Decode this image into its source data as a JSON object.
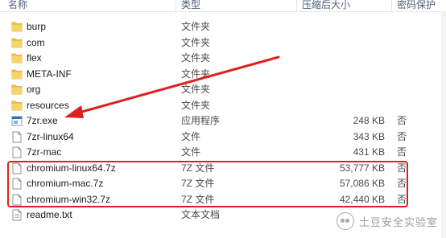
{
  "columns": {
    "name": "名称",
    "type": "类型",
    "size": "压缩后大小",
    "protected": "密码保护"
  },
  "files": [
    {
      "name": "burp",
      "type": "文件夹",
      "size": "",
      "protected": "",
      "icon": "folder-icon"
    },
    {
      "name": "com",
      "type": "文件夹",
      "size": "",
      "protected": "",
      "icon": "folder-icon"
    },
    {
      "name": "flex",
      "type": "文件夹",
      "size": "",
      "protected": "",
      "icon": "folder-icon"
    },
    {
      "name": "META-INF",
      "type": "文件夹",
      "size": "",
      "protected": "",
      "icon": "folder-icon"
    },
    {
      "name": "org",
      "type": "文件夹",
      "size": "",
      "protected": "",
      "icon": "folder-icon"
    },
    {
      "name": "resources",
      "type": "文件夹",
      "size": "",
      "protected": "",
      "icon": "folder-icon"
    },
    {
      "name": "7zr.exe",
      "type": "应用程序",
      "size": "248 KB",
      "protected": "否",
      "icon": "exe-icon"
    },
    {
      "name": "7zr-linux64",
      "type": "文件",
      "size": "343 KB",
      "protected": "否",
      "icon": "file-icon"
    },
    {
      "name": "7zr-mac",
      "type": "文件",
      "size": "431 KB",
      "protected": "否",
      "icon": "file-icon"
    },
    {
      "name": "chromium-linux64.7z",
      "type": "7Z 文件",
      "size": "53,777 KB",
      "protected": "否",
      "icon": "file-icon"
    },
    {
      "name": "chromium-mac.7z",
      "type": "7Z 文件",
      "size": "57,086 KB",
      "protected": "否",
      "icon": "file-icon"
    },
    {
      "name": "chromium-win32.7z",
      "type": "7Z 文件",
      "size": "42,440 KB",
      "protected": "否",
      "icon": "file-icon"
    },
    {
      "name": "readme.txt",
      "type": "文本文档",
      "size": "",
      "protected": "",
      "icon": "text-file-icon"
    }
  ],
  "watermark": "土豆安全实验室",
  "colors": {
    "highlight": "#e02020",
    "folder": "#f4c24a"
  }
}
